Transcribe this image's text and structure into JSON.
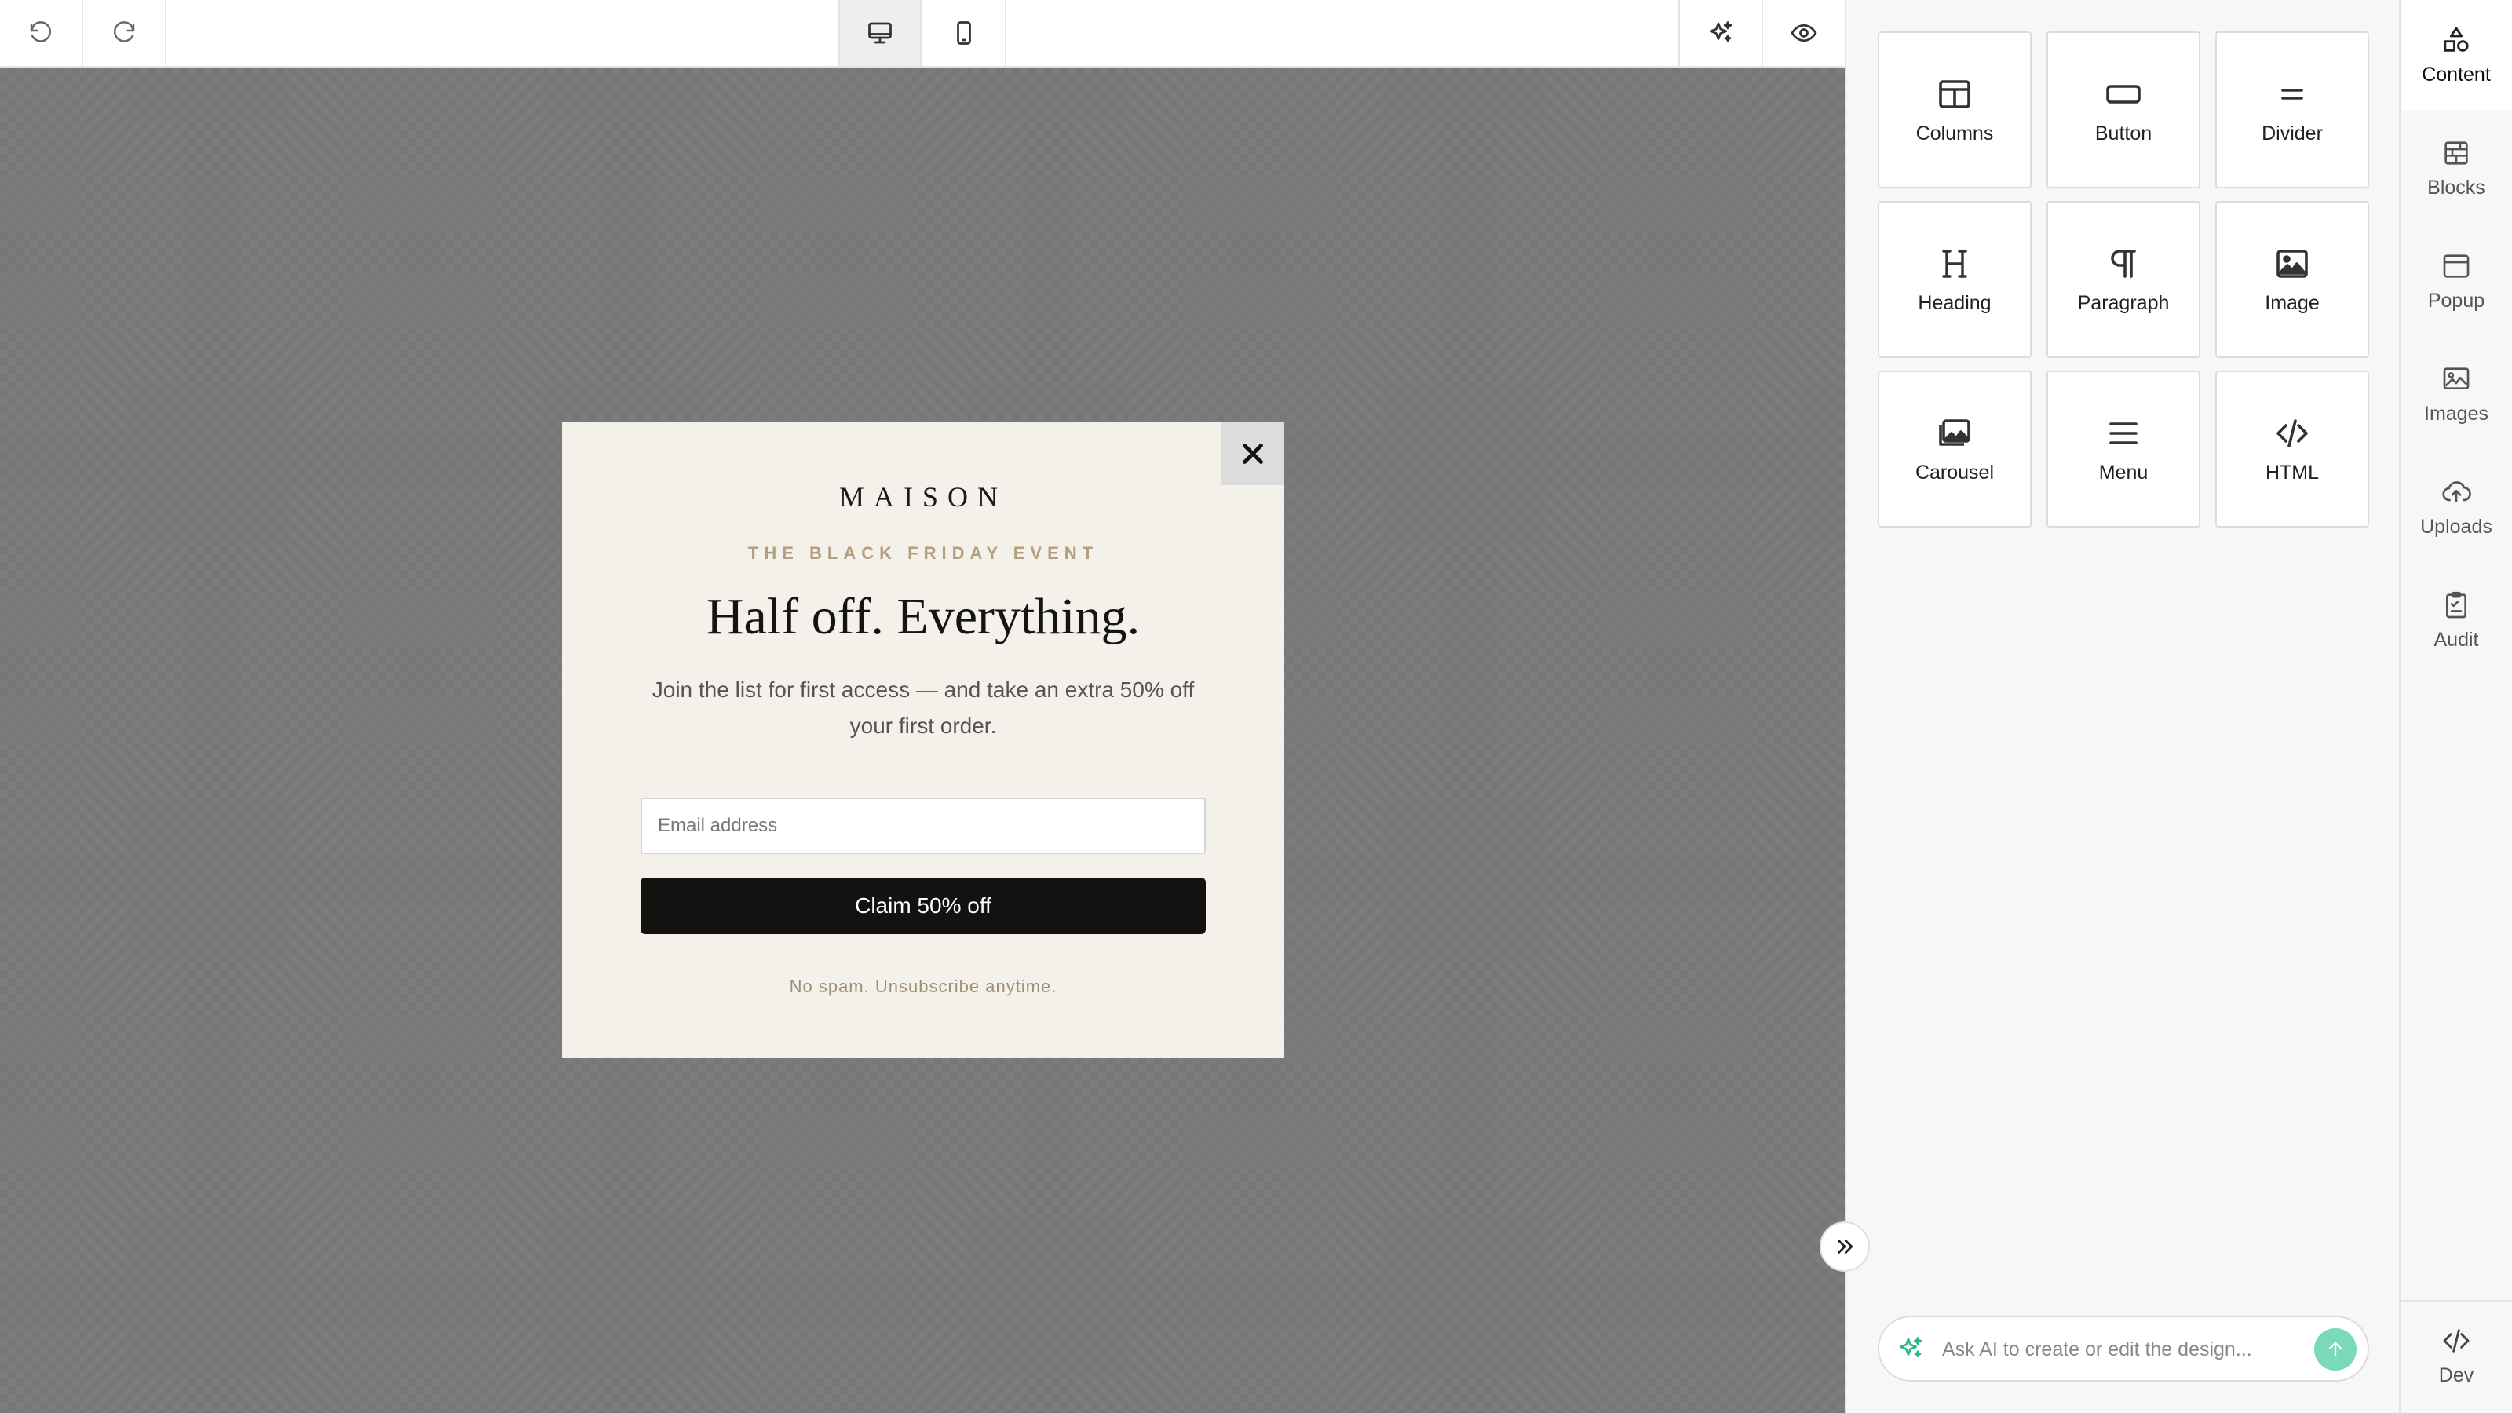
{
  "toolbar": {
    "undo_icon": "undo-icon",
    "redo_icon": "redo-icon",
    "desktop_icon": "desktop-icon",
    "mobile_icon": "mobile-icon",
    "ai_icon": "sparkle-icon",
    "preview_icon": "eye-icon",
    "active_view": "desktop"
  },
  "popup": {
    "brand": "MAISON",
    "eyebrow": "THE BLACK FRIDAY EVENT",
    "headline": "Half off. Everything.",
    "subtext": "Join the list for first access — and take an extra 50% off your first order.",
    "email_placeholder": "Email address",
    "button_label": "Claim 50% off",
    "fineprint": "No spam. Unsubscribe anytime.",
    "background_color": "#f4f0ea",
    "button_color": "#141111"
  },
  "content_tiles": [
    {
      "label": "Columns",
      "icon": "columns-icon"
    },
    {
      "label": "Button",
      "icon": "button-icon"
    },
    {
      "label": "Divider",
      "icon": "divider-icon"
    },
    {
      "label": "Heading",
      "icon": "heading-icon"
    },
    {
      "label": "Paragraph",
      "icon": "paragraph-icon"
    },
    {
      "label": "Image",
      "icon": "image-icon"
    },
    {
      "label": "Carousel",
      "icon": "carousel-icon"
    },
    {
      "label": "Menu",
      "icon": "menu-icon"
    },
    {
      "label": "HTML",
      "icon": "code-icon"
    }
  ],
  "ai": {
    "placeholder": "Ask AI to create or edit the design...",
    "send_color": "#7ad9b7"
  },
  "nav": [
    {
      "label": "Content",
      "icon": "shapes-icon",
      "active": true
    },
    {
      "label": "Blocks",
      "icon": "blocks-icon"
    },
    {
      "label": "Popup",
      "icon": "popup-icon"
    },
    {
      "label": "Images",
      "icon": "images-icon"
    },
    {
      "label": "Uploads",
      "icon": "upload-cloud-icon"
    },
    {
      "label": "Audit",
      "icon": "clipboard-icon"
    }
  ],
  "nav_dev": {
    "label": "Dev",
    "icon": "code-icon"
  }
}
